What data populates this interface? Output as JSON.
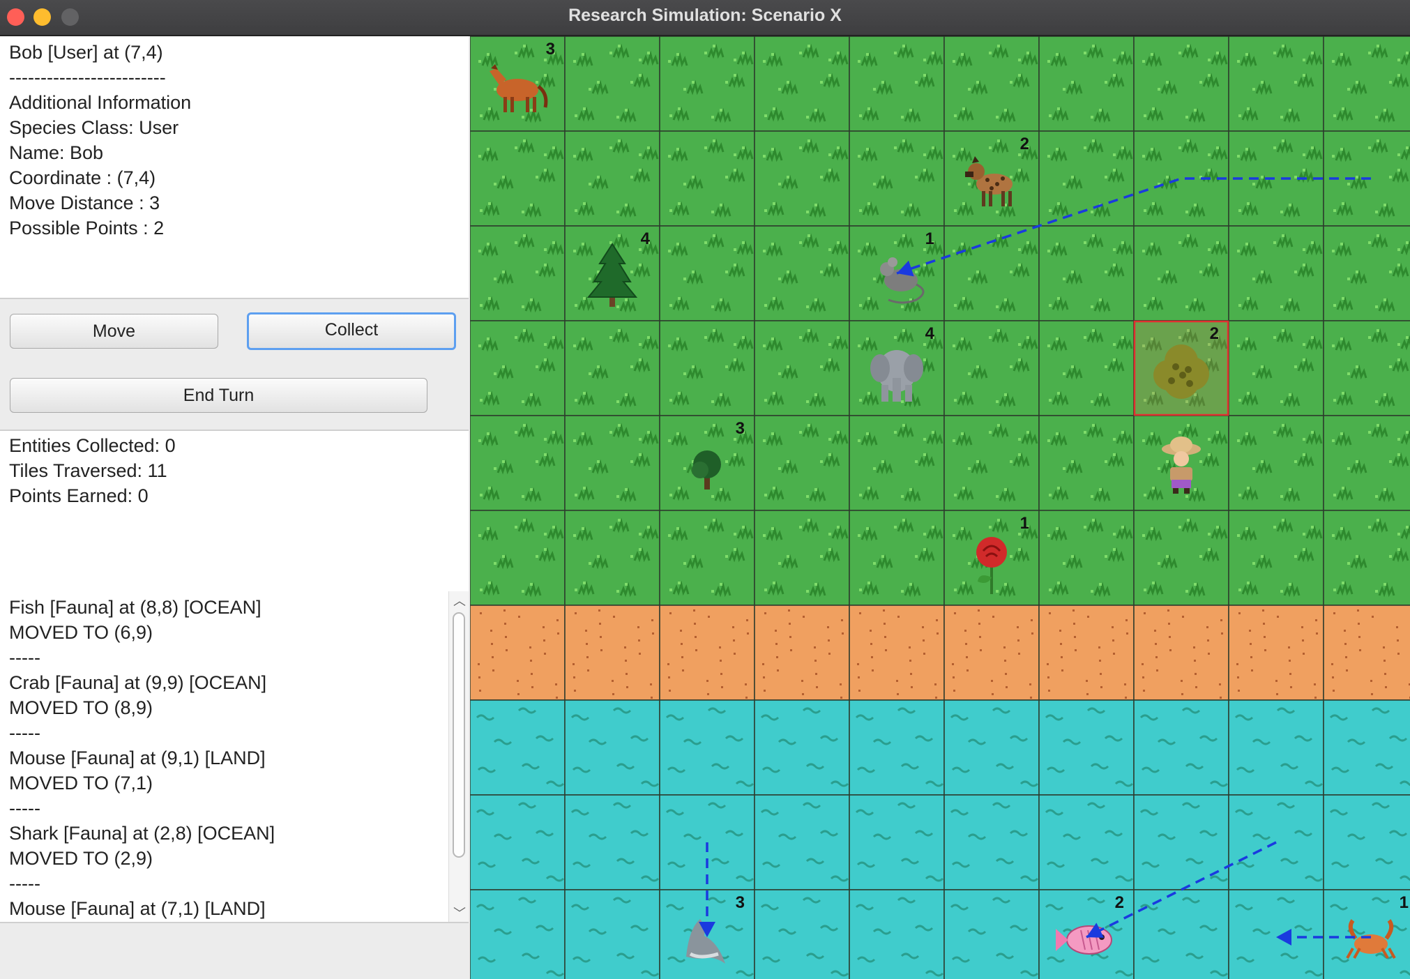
{
  "window": {
    "title": "Research Simulation: Scenario X"
  },
  "info": {
    "lines": [
      "Bob [User] at (7,4)",
      "-------------------------",
      "Additional Information",
      "Species Class: User",
      "Name: Bob",
      "Coordinate : (7,4)",
      "Move Distance : 3",
      "Possible Points : 2"
    ]
  },
  "buttons": {
    "move": "Move",
    "collect": "Collect",
    "end_turn": "End Turn"
  },
  "stats": {
    "lines": [
      "Entities Collected: 0",
      "Tiles Traversed: 11",
      "Points Earned: 0"
    ]
  },
  "log": {
    "lines": [
      "Fish [Fauna] at (8,8) [OCEAN]",
      "MOVED TO (6,9)",
      "-----",
      "Crab [Fauna] at (9,9) [OCEAN]",
      "MOVED TO (8,9)",
      "-----",
      "Mouse [Fauna] at (9,1) [LAND]",
      "MOVED TO (7,1)",
      "-----",
      "Shark [Fauna] at (2,8) [OCEAN]",
      "MOVED TO (2,9)",
      "-----",
      "Mouse [Fauna] at (7,1) [LAND]"
    ]
  },
  "board": {
    "columns_visible": 10,
    "rows_visible": 10,
    "terrain_rows": [
      "grass",
      "grass",
      "grass",
      "grass",
      "grass",
      "grass",
      "sand",
      "water",
      "water",
      "water"
    ],
    "colors": {
      "grass": "#4bb04c",
      "sand": "#f0a060",
      "water": "#40cccc",
      "path": "#1a3adf",
      "selection": "#e03030"
    },
    "selected_cell": {
      "col": 7,
      "row": 3
    },
    "entities": [
      {
        "name": "horse",
        "icon": "horse-icon",
        "col": 0,
        "row": 0,
        "points": "3"
      },
      {
        "name": "hyena",
        "icon": "hyena-icon",
        "col": 5,
        "row": 1,
        "points": "2"
      },
      {
        "name": "pine-tree",
        "icon": "pine-tree-icon",
        "col": 1,
        "row": 2,
        "points": "4"
      },
      {
        "name": "mouse",
        "icon": "mouse-icon",
        "col": 4,
        "row": 2,
        "points": "1"
      },
      {
        "name": "elephant",
        "icon": "elephant-icon",
        "col": 4,
        "row": 3,
        "points": "4"
      },
      {
        "name": "bush",
        "icon": "bush-icon",
        "col": 7,
        "row": 3,
        "points": "2"
      },
      {
        "name": "small-tree",
        "icon": "small-tree-icon",
        "col": 2,
        "row": 4,
        "points": "3"
      },
      {
        "name": "user-bob",
        "icon": "explorer-icon",
        "col": 7,
        "row": 4,
        "points": ""
      },
      {
        "name": "rose",
        "icon": "rose-icon",
        "col": 5,
        "row": 5,
        "points": "1"
      },
      {
        "name": "shark",
        "icon": "shark-icon",
        "col": 2,
        "row": 9,
        "points": "3"
      },
      {
        "name": "fish",
        "icon": "fish-icon",
        "col": 6,
        "row": 9,
        "points": "2"
      },
      {
        "name": "crab",
        "icon": "crab-icon",
        "col": 9,
        "row": 9,
        "points": "1"
      }
    ],
    "paths": [
      {
        "name": "mouse-path",
        "points": [
          [
            9.5,
            1.5
          ],
          [
            7.5,
            1.5
          ],
          [
            4.5,
            2.5
          ]
        ]
      },
      {
        "name": "shark-path",
        "points": [
          [
            2.5,
            8.5
          ],
          [
            2.5,
            9.5
          ]
        ]
      },
      {
        "name": "fish-path",
        "points": [
          [
            8.5,
            8.5
          ],
          [
            6.5,
            9.5
          ]
        ]
      },
      {
        "name": "crab-path",
        "points": [
          [
            9.5,
            9.5
          ],
          [
            8.5,
            9.5
          ]
        ]
      }
    ]
  }
}
